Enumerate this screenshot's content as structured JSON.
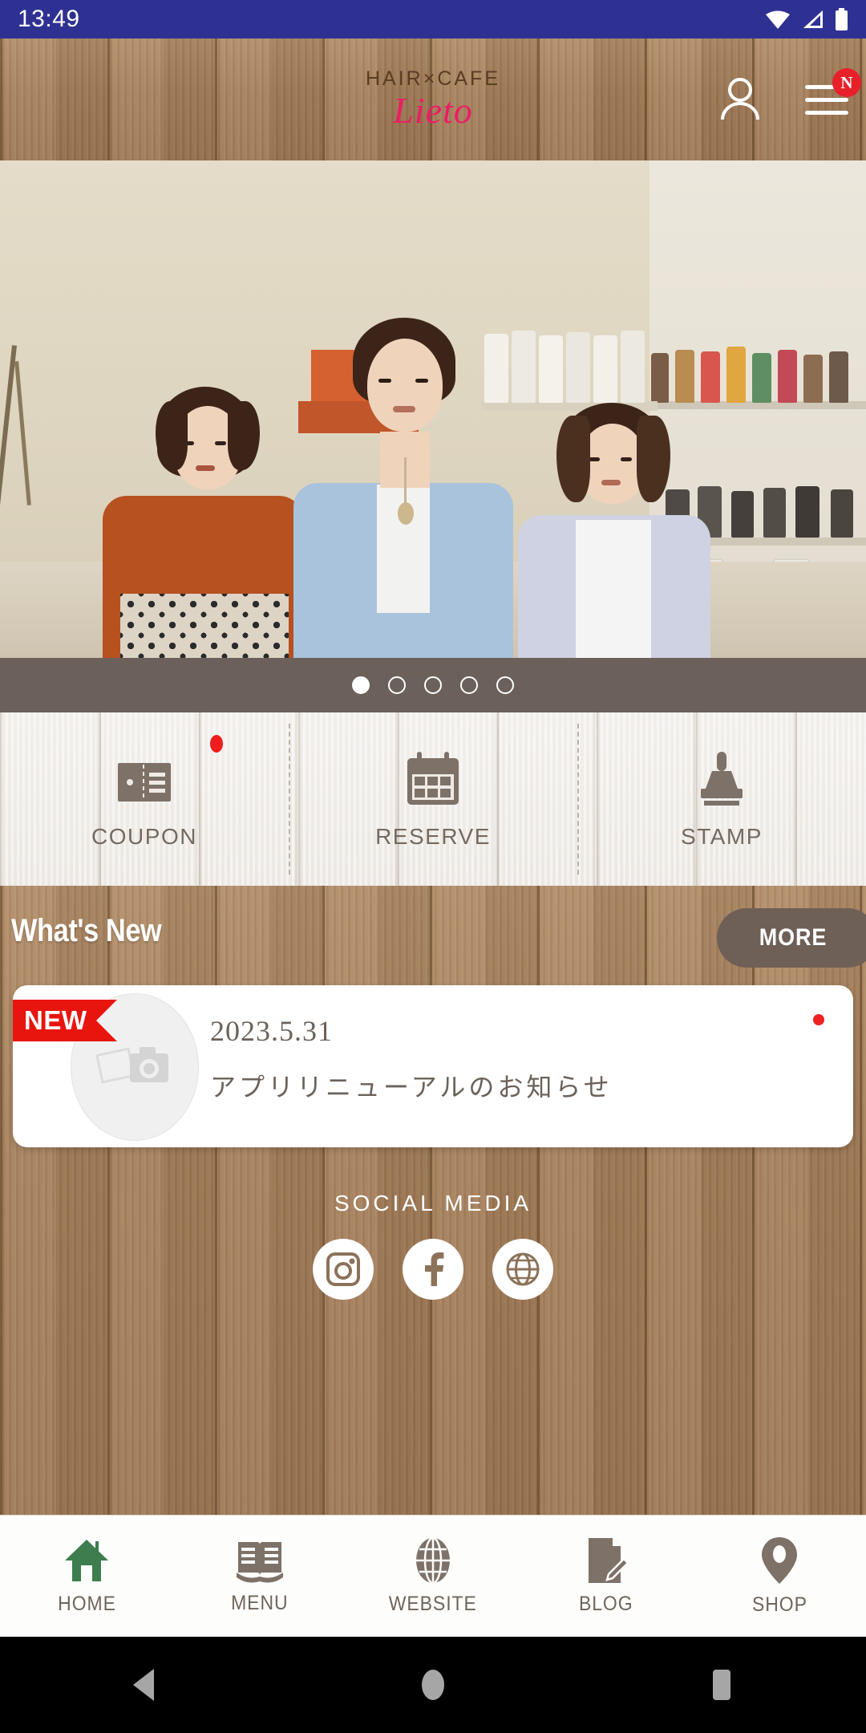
{
  "status_bar": {
    "time": "13:49",
    "icons": [
      "wifi-icon",
      "signal-icon",
      "battery-icon"
    ],
    "background_color": "#2f3192"
  },
  "header": {
    "logo_top": "HAIR×CAFE",
    "logo_main": "Lieto",
    "logo_main_color": "#ec1d63",
    "account_icon": "person-icon",
    "menu_icon": "hamburger-menu-icon",
    "menu_badge": "N",
    "menu_badge_color": "#e8202a"
  },
  "hero": {
    "alt": "three salon staff standing in front of product shelves",
    "carousel_dots": 5,
    "active_dot_index": 0,
    "bar_color": "#6b605a"
  },
  "quick_actions": [
    {
      "label": "COUPON",
      "icon": "coupon-ticket-icon",
      "badge": true
    },
    {
      "label": "RESERVE",
      "icon": "calendar-icon",
      "badge": false
    },
    {
      "label": "STAMP",
      "icon": "stamp-icon",
      "badge": false
    }
  ],
  "whats_new": {
    "title": "What's New",
    "more_label": "MORE",
    "more_color": "#6e6057",
    "items": [
      {
        "badge": "NEW",
        "badge_color": "#e8150f",
        "date": "2023.5.31",
        "title": "アプリリニューアルのお知らせ",
        "thumbnail_icon": "photo-camera-placeholder-icon",
        "unread": true
      }
    ]
  },
  "social": {
    "title": "SOCIAL MEDIA",
    "items": [
      {
        "name": "instagram",
        "icon": "instagram-icon"
      },
      {
        "name": "facebook",
        "icon": "facebook-icon"
      },
      {
        "name": "website",
        "icon": "globe-icon"
      }
    ]
  },
  "bottom_nav": {
    "active": "HOME",
    "active_color": "#3d7d4e",
    "inactive_color": "#6e655c",
    "items": [
      {
        "label": "HOME",
        "icon": "home-icon"
      },
      {
        "label": "MENU",
        "icon": "book-icon"
      },
      {
        "label": "WEBSITE",
        "icon": "globe-icon"
      },
      {
        "label": "BLOG",
        "icon": "document-pen-icon"
      },
      {
        "label": "SHOP",
        "icon": "map-pin-icon"
      }
    ]
  },
  "android_nav": {
    "items": [
      {
        "name": "back",
        "icon": "triangle-back-icon"
      },
      {
        "name": "home",
        "icon": "circle-home-icon"
      },
      {
        "name": "recents",
        "icon": "square-recents-icon"
      }
    ]
  },
  "theme": {
    "wood_dark": "#a8815c",
    "wood_light": "#e9e4dd",
    "brown_text": "#6e655c"
  }
}
